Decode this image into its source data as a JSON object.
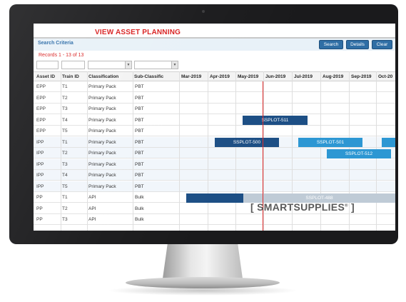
{
  "app": {
    "title": "VIEW ASSET PLANNING",
    "search_criteria_label": "Search Criteria",
    "records_label": "Records 1 - 13 of 13",
    "buttons": {
      "search": "Search",
      "details": "Details",
      "clear": "Clear"
    }
  },
  "grid": {
    "columns": [
      "Asset ID",
      "Train ID",
      "Classification",
      "Sub-Classific",
      "Mar-2019",
      "Apr-2019",
      "May-2019",
      "Jun-2019",
      "Jul-2019",
      "Aug-2019",
      "Sep-2019",
      "Oct-20"
    ],
    "rows": [
      [
        "EPP",
        "T1",
        "Primary Pack",
        "PBT"
      ],
      [
        "EPP",
        "T2",
        "Primary Pack",
        "PBT"
      ],
      [
        "EPP",
        "T3",
        "Primary Pack",
        "PBT"
      ],
      [
        "EPP",
        "T4",
        "Primary Pack",
        "PBT"
      ],
      [
        "EPP",
        "T5",
        "Primary Pack",
        "PBT"
      ],
      [
        "IPP",
        "T1",
        "Primary Pack",
        "PBT"
      ],
      [
        "IPP",
        "T2",
        "Primary Pack",
        "PBT"
      ],
      [
        "IPP",
        "T3",
        "Primary Pack",
        "PBT"
      ],
      [
        "IPP",
        "T4",
        "Primary Pack",
        "PBT"
      ],
      [
        "IPP",
        "T5",
        "Primary Pack",
        "PBT"
      ],
      [
        "PP",
        "T1",
        "API",
        "Bulk"
      ],
      [
        "PP",
        "T2",
        "API",
        "Bulk"
      ],
      [
        "PP",
        "T3",
        "API",
        "Bulk"
      ]
    ]
  },
  "bars": [
    {
      "label": "SSPLOT-511",
      "color": "#1d4f85"
    },
    {
      "label": "SSPLOT-500",
      "color": "#1d4f85"
    },
    {
      "label": "SSPLOT-501",
      "color": "#2d97d3"
    },
    {
      "label": "SSPLOT-512",
      "color": "#2d97d3"
    },
    {
      "label": "SSPLOT-488",
      "color": "#bfcbd6"
    }
  ],
  "brand": {
    "name": "SMARTSUPPLIES",
    "mark": "®",
    "bracket_left": "[",
    "bracket_right": "]"
  },
  "colors": {
    "accent_red": "#d81c1c",
    "button_blue": "#2f6ea5",
    "bar_dark": "#1d4f85",
    "bar_light": "#2d97d3"
  }
}
